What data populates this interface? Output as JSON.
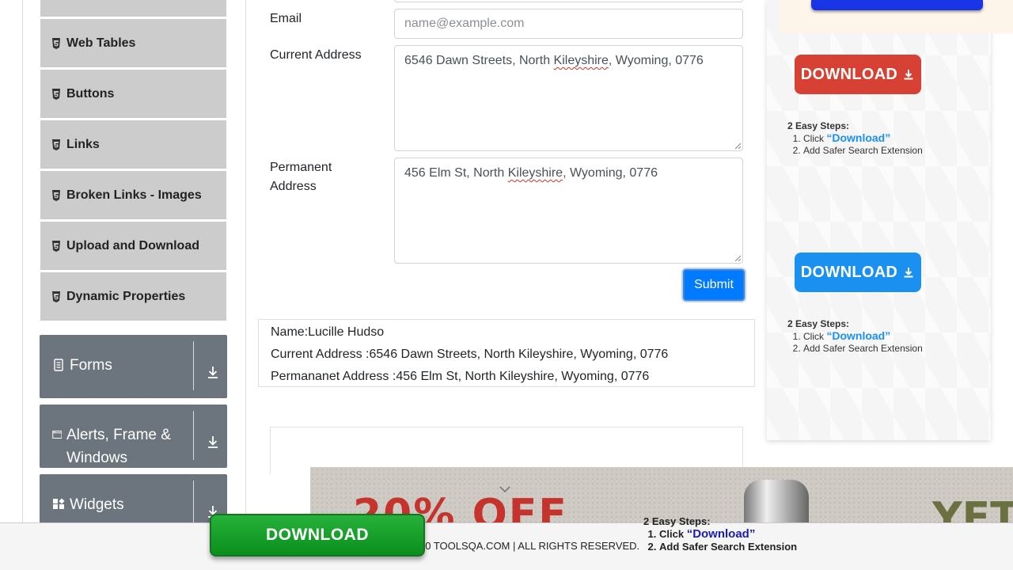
{
  "sidebar": {
    "items": [
      {
        "label": ""
      },
      {
        "label": "Web Tables"
      },
      {
        "label": "Buttons"
      },
      {
        "label": "Links"
      },
      {
        "label": "Broken Links - Images"
      },
      {
        "label": "Upload and Download"
      },
      {
        "label": "Dynamic Properties"
      }
    ],
    "groups": [
      {
        "label": "Forms",
        "icon": "document-icon"
      },
      {
        "label": "Alerts, Frame & Windows",
        "icon": "window-icon"
      },
      {
        "label": "Widgets",
        "icon": "widgets-icon"
      }
    ]
  },
  "form": {
    "email_label": "Email",
    "email_placeholder": "name@example.com",
    "current_address_label": "Current Address",
    "current_address_value": {
      "pre": "6546 Dawn Streets, North ",
      "flag": "Kileyshire",
      "post": ", Wyoming, 0776"
    },
    "permanent_address_label_1": "Permanent",
    "permanent_address_label_2": "Address",
    "permanent_address_value": {
      "pre": "456 Elm St, North ",
      "flag": "Kileyshire",
      "post": ", Wyoming, 0776"
    },
    "submit_label": "Submit"
  },
  "output": {
    "name": "Name:Lucille Hudso",
    "current_address": "Current Address :6546 Dawn Streets, North Kileyshire, Wyoming, 0776",
    "permanent_address": "Permananet Address :456 Elm St, North Kileyshire, Wyoming, 0776"
  },
  "ads": {
    "right": {
      "download_label": "DOWNLOAD",
      "steps_title": "2 Easy Steps:",
      "step1_prefix": "Click ",
      "step1_link": "“Download”",
      "step2": "Add Safer Search Extension",
      "colors": {
        "red_button": "#d64134",
        "blue_button": "#1a90f0"
      }
    },
    "bottom": {
      "offer": "20% OFF",
      "brand": "YET",
      "steps_title": "2 Easy Steps:",
      "step1_prefix": "Click ",
      "step1_link": "“Download”",
      "step2": "Add Safer Search Extension"
    },
    "footer_download_label": "DOWNLOAD"
  },
  "footer": {
    "text": "20 TOOLSQA.COM | ALL RIGHTS RESERVED."
  }
}
